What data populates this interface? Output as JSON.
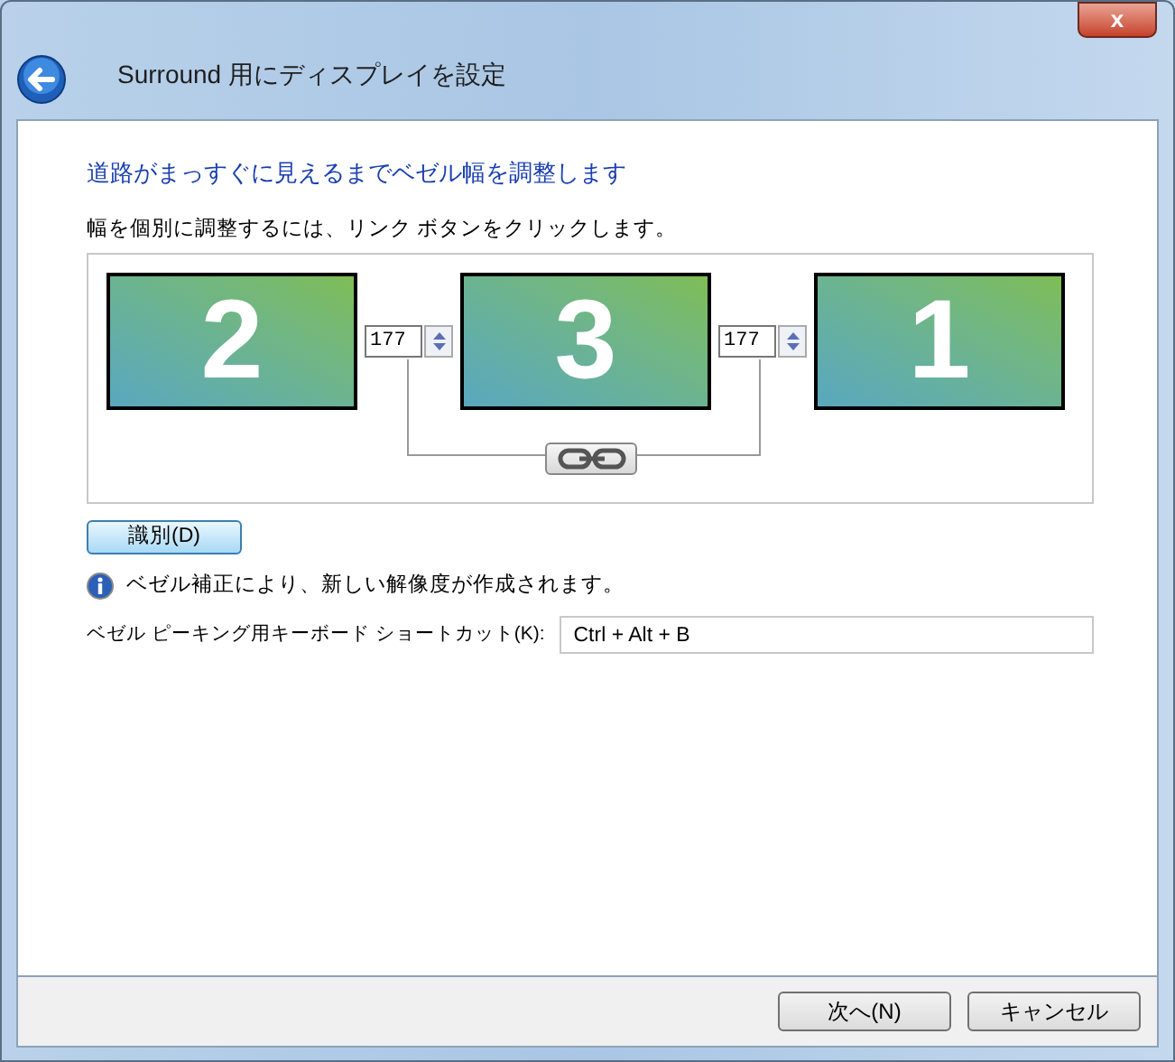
{
  "window": {
    "title": "Surround 用にディスプレイを設定",
    "close": "x"
  },
  "heading": "道路がまっすぐに見えるまでベゼル幅を調整します",
  "instruction": "幅を個別に調整するには、リンク ボタンをクリックします。",
  "monitors": [
    {
      "number": "2"
    },
    {
      "number": "3"
    },
    {
      "number": "1"
    }
  ],
  "bezels": [
    {
      "value": "177"
    },
    {
      "value": "177"
    }
  ],
  "identify_button": "識別(D)",
  "info": "ベゼル補正により、新しい解像度が作成されます。",
  "shortcut": {
    "label": "ベゼル ピーキング用キーボード ショートカット(K):",
    "value": "Ctrl + Alt + B"
  },
  "buttons": [
    {
      "label": "次へ(N)"
    },
    {
      "label": "キャンセル"
    }
  ]
}
